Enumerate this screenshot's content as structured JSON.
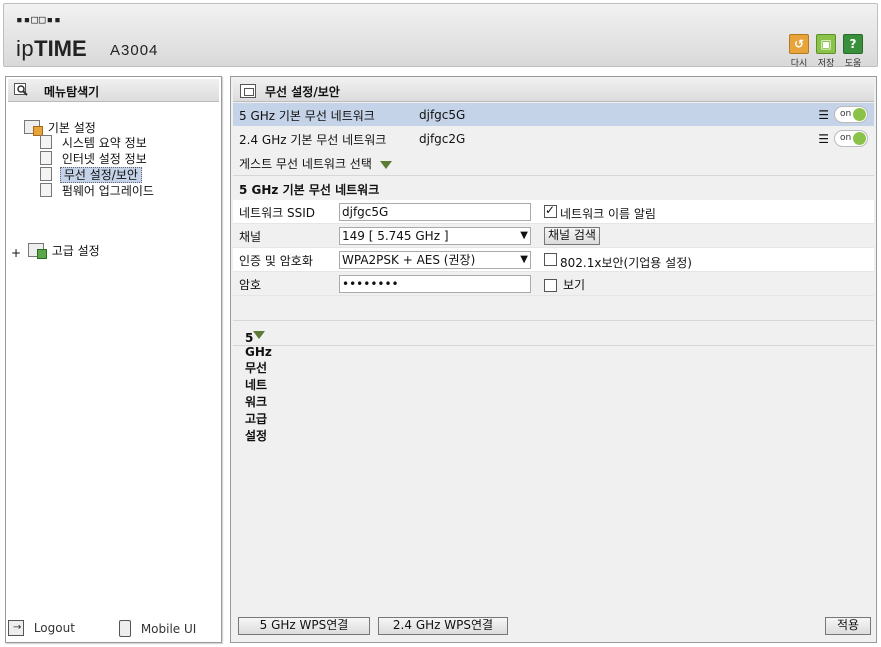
{
  "header": {
    "logo_dots": "▪▪□□▪▪",
    "brand": "ipTIME",
    "model": "A3004",
    "buttons": [
      {
        "label": "다시",
        "icon": "refresh-icon",
        "color": "#e8a33a"
      },
      {
        "label": "저장",
        "icon": "save-icon",
        "color": "#8bc34a"
      },
      {
        "label": "도움",
        "icon": "help-icon",
        "color": "#3a8f3a"
      }
    ]
  },
  "sidebar": {
    "title": "메뉴탐색기",
    "basic_label": "기본 설정",
    "items": [
      {
        "label": "시스템 요약 정보"
      },
      {
        "label": "인터넷 설정 정보"
      },
      {
        "label": "무선 설정/보안",
        "selected": true
      },
      {
        "label": "펌웨어 업그레이드"
      }
    ],
    "advanced_expander": "+",
    "advanced_label": "고급 설정",
    "logout": "Logout",
    "mobile": "Mobile UI"
  },
  "main": {
    "title": "무선 설정/보안",
    "networks": [
      {
        "name": "5 GHz 기본 무선 네트워크",
        "ssid": "djfgc5G",
        "toggle": "on",
        "highlight": true
      },
      {
        "name": "2.4 GHz 기본 무선 네트워크",
        "ssid": "djfgc2G",
        "toggle": "on",
        "highlight": false
      }
    ],
    "guest_select": "게스트 무선 네트워크 선택",
    "section_5g": "5 GHz 기본 무선 네트워크",
    "form": {
      "ssid_label": "네트워크 SSID",
      "ssid_value": "djfgc5G",
      "broadcast_label": "네트워크 이름 알림",
      "broadcast_checked": true,
      "channel_label": "채널",
      "channel_value": "149 [ 5.745 GHz ]",
      "channel_scan": "채널 검색",
      "auth_label": "인증 및 암호화",
      "auth_value": "WPA2PSK + AES (권장)",
      "enterprise_label": "802.1x보안(기업용 설정)",
      "enterprise_checked": false,
      "password_label": "암호",
      "password_value": "••••••••",
      "show_label": "보기",
      "show_checked": false
    },
    "advanced_title": "5 GHz 무선 네트워크 고급 설정",
    "footer": {
      "wps5": "5 GHz WPS연결",
      "wps24": "2.4 GHz WPS연결",
      "apply": "적용"
    }
  },
  "colors": {
    "highlight_row": "#c5d3e8",
    "toggle_on": "#8bc34a",
    "selected_menu": "#c5d3e8",
    "triangle": "#5b7a34"
  }
}
